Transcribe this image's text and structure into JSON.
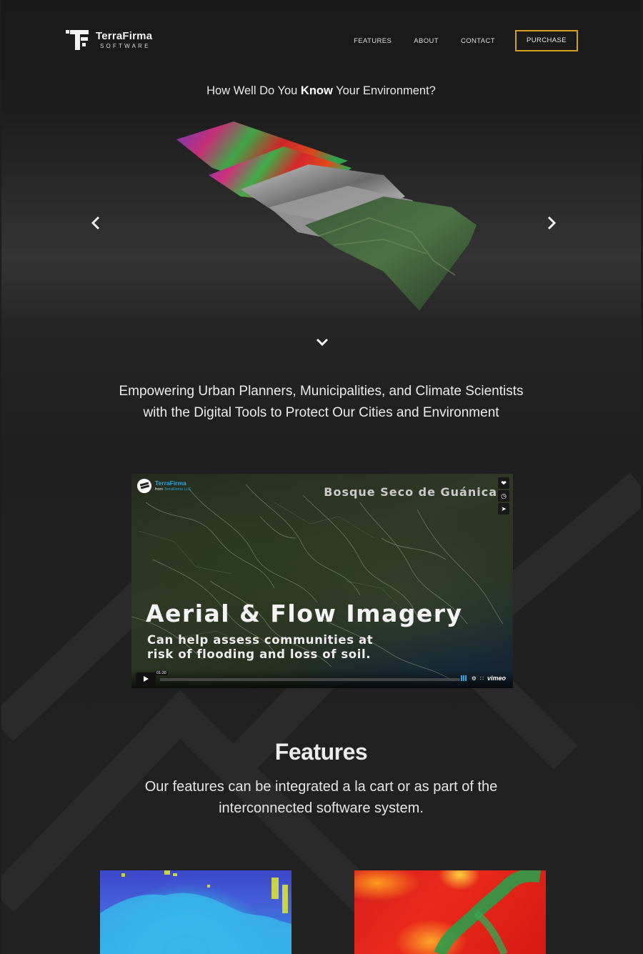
{
  "header": {
    "logo_name": "TerraFirma",
    "logo_sub": "SOFTWARE",
    "nav": [
      "FEATURES",
      "ABOUT",
      "CONTACT"
    ],
    "purchase_label": "PURCHASE"
  },
  "hero": {
    "tagline_pre": "How Well Do You ",
    "tagline_bold": "Know",
    "tagline_post": " Your Environment?",
    "prev_icon": "chevron-left-icon",
    "next_icon": "chevron-right-icon",
    "scroll_icon": "chevron-down-icon"
  },
  "mission": {
    "line1": "Empowering Urban Planners, Municipalities, and Climate Scientists",
    "line2": "with the Digital Tools to Protect Our Cities and Environment"
  },
  "video": {
    "channel": "TerraFirma",
    "from_label": "from ",
    "from_owner": "TerraFirma LLC",
    "location": "Bosque Seco de Guánica",
    "heading": "Aerial & Flow Imagery",
    "subtitle_line1": "Can help assess communities at",
    "subtitle_line2": "risk of flooding and loss of soil.",
    "time": "01:30",
    "brand": "vimeo",
    "side_icons": [
      "heart-icon",
      "clock-icon",
      "send-icon"
    ]
  },
  "features": {
    "title": "Features",
    "desc_line1": "Our features can be integrated a la cart or as part of the",
    "desc_line2": "interconnected software system."
  },
  "colors": {
    "accent": "#d4a11e",
    "vimeo_blue": "#2aa6e0",
    "background": "#1e1e1e"
  }
}
